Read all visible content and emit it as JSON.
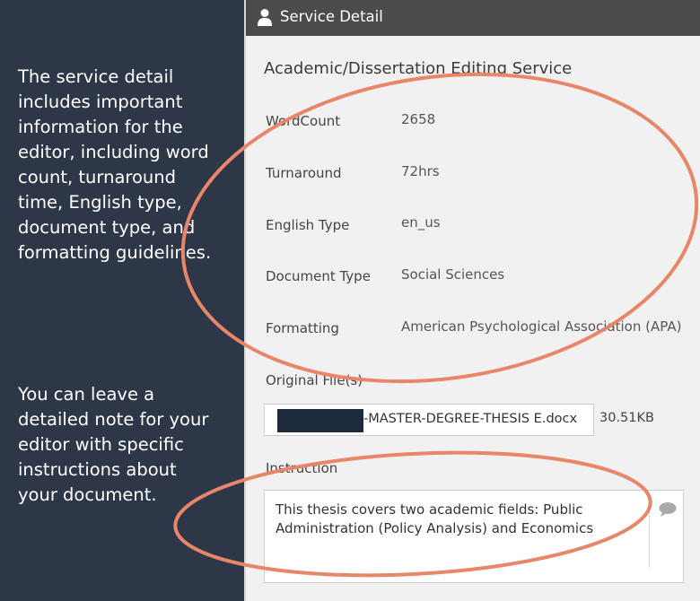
{
  "sidebar": {
    "note_detail": "The service detail\nincludes important\ninformation for the\neditor, including word\ncount, turnaround\ntime, English type,\ndocument type, and\nformatting guidelines.",
    "note_instruction": "You can leave a\ndetailed note for your\neditor with specific\ninstructions about\nyour document."
  },
  "header": {
    "icon": "user-icon",
    "title": "Service Detail"
  },
  "service": {
    "title": "Academic/Dissertation Editing Service",
    "fields": [
      {
        "label": "WordCount",
        "value": "2658"
      },
      {
        "label": "Turnaround",
        "value": "72hrs"
      },
      {
        "label": "English Type",
        "value": "en_us"
      },
      {
        "label": "Document Type",
        "value": "Social Sciences"
      },
      {
        "label": "Formatting",
        "value": "American Psychological Association (APA)"
      }
    ]
  },
  "files": {
    "label": "Original File(s)",
    "name": "-MASTER-DEGREE-THESIS E.docx",
    "size": "30.51KB"
  },
  "instruction": {
    "label": "Instruction",
    "text": "This thesis covers two academic fields: Public Administration (Policy Analysis) and Economics",
    "icon": "chat-bubble-icon"
  },
  "colors": {
    "sidebar": "#2e3748",
    "header": "#4b4b4b",
    "annotation": "#e8866a"
  }
}
